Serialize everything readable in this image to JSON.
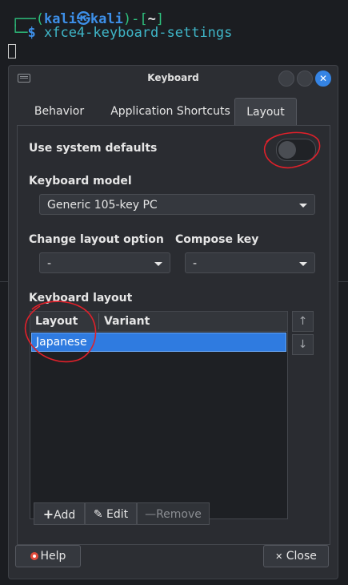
{
  "terminal": {
    "user": "kali",
    "at": "㉿",
    "host": "kali",
    "cwd": "~",
    "command": "xfce4-keyboard-settings"
  },
  "dialog": {
    "title": "Keyboard",
    "tabs": [
      {
        "label": "Behavior"
      },
      {
        "label": "Application Shortcuts"
      },
      {
        "label": "Layout",
        "active": true
      }
    ],
    "use_system_defaults": {
      "label": "Use system defaults",
      "enabled": false
    },
    "keyboard_model": {
      "label": "Keyboard model",
      "value": "Generic 105-key PC"
    },
    "change_layout_option": {
      "label": "Change layout option",
      "value": "-"
    },
    "compose_key": {
      "label": "Compose key",
      "value": "-"
    },
    "keyboard_layout": {
      "label": "Keyboard layout",
      "columns": [
        "Layout",
        "Variant"
      ],
      "rows": [
        {
          "layout": "Japanese",
          "variant": "",
          "selected": true
        }
      ]
    },
    "toolbar": {
      "add": "Add",
      "edit": "Edit",
      "remove": "Remove"
    },
    "footer": {
      "help": "Help",
      "close": "Close"
    }
  },
  "colors": {
    "accent": "#3584e4",
    "selection": "#2f7be0",
    "annotation": "#e0202a",
    "terminal_prompt": "#2ec27e",
    "terminal_user": "#3d8fe8"
  }
}
